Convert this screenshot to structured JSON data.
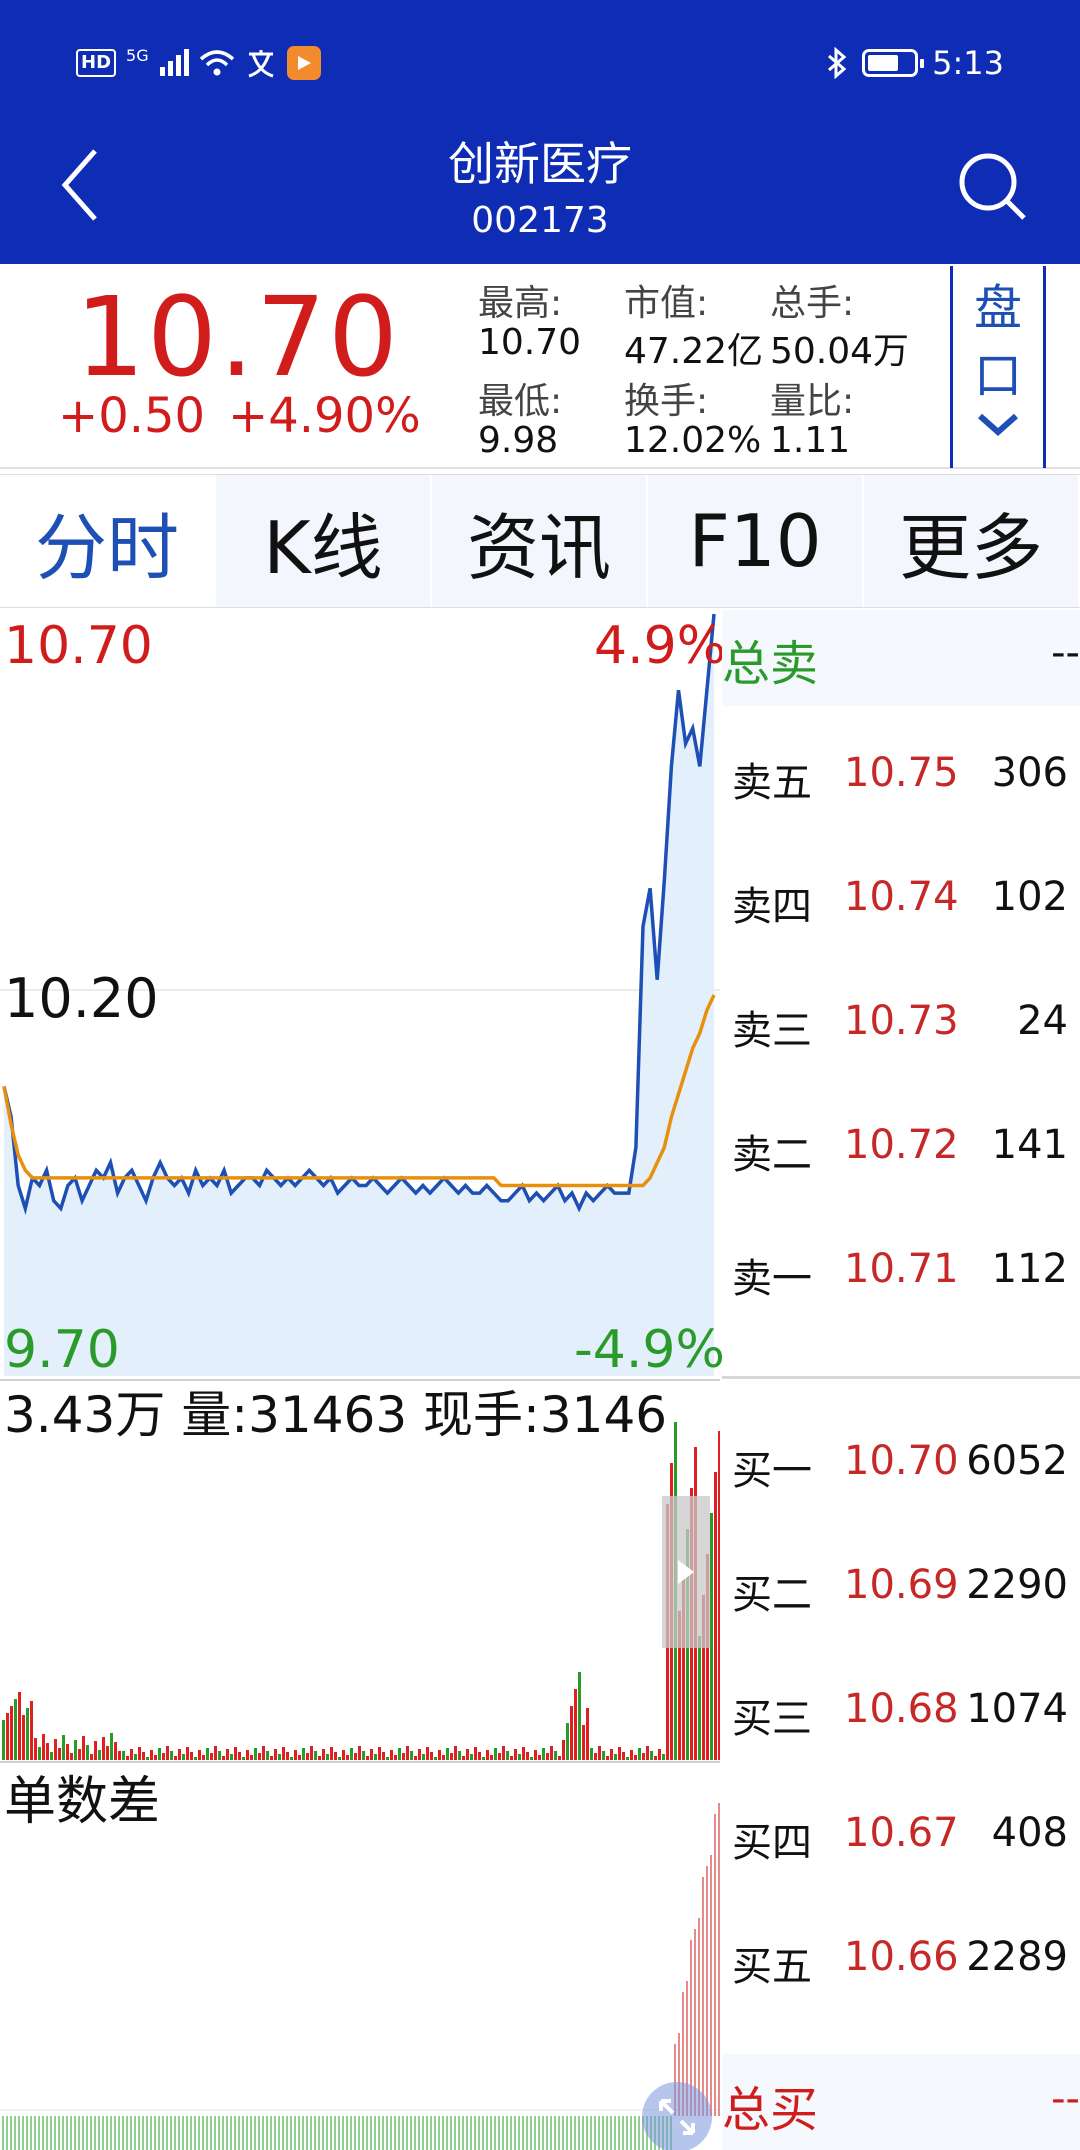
{
  "status_bar": {
    "hd": "HD",
    "network": "5G",
    "app_badge_icon": "orange-play-icon",
    "time": "5:13"
  },
  "header": {
    "name": "创新医疗",
    "code": "002173",
    "back_icon": "chevron-left-icon",
    "search_icon": "search-icon",
    "background": "#0f2db4"
  },
  "quote": {
    "price": "10.70",
    "change": "+0.50",
    "change_pct": "+4.90%",
    "stats": [
      {
        "label": "最高:",
        "value": "10.70"
      },
      {
        "label": "市值:",
        "value": "47.22亿"
      },
      {
        "label": "总手:",
        "value": "50.04万"
      },
      {
        "label": "最低:",
        "value": "9.98"
      },
      {
        "label": "换手:",
        "value": "12.02%"
      },
      {
        "label": "量比:",
        "value": "1.11"
      }
    ],
    "pankou": [
      "盘",
      "口"
    ],
    "pankou_icon": "chevron-down-icon",
    "up_color": "#d11c1c"
  },
  "tabs": [
    {
      "label": "分时",
      "active": true
    },
    {
      "label": "K线",
      "active": false
    },
    {
      "label": "资讯",
      "active": false
    },
    {
      "label": "F10",
      "active": false
    },
    {
      "label": "更多",
      "active": false
    }
  ],
  "chart": {
    "price_top": "10.70",
    "price_mid": "10.20",
    "price_bottom": "9.70",
    "pct_top": "4.9%",
    "pct_bottom": "-4.9%",
    "volume_info": "3.43万 量:31463 现手:3146",
    "lower_label": "单数差",
    "expand_icon": "expand-icon",
    "drawer_icon": "play-right-icon"
  },
  "chart_data": {
    "type": "line",
    "ylim": [
      9.7,
      10.7
    ],
    "y_labels": [
      "10.70",
      "10.20",
      "9.70"
    ],
    "pct_labels": [
      "4.9%",
      "-4.9%"
    ],
    "series": [],
    "price_series": [
      10.08,
      10.04,
      9.95,
      9.92,
      9.96,
      9.95,
      9.97,
      9.93,
      9.92,
      9.95,
      9.96,
      9.93,
      9.95,
      9.97,
      9.96,
      9.98,
      9.94,
      9.96,
      9.97,
      9.95,
      9.93,
      9.96,
      9.98,
      9.96,
      9.95,
      9.96,
      9.94,
      9.97,
      9.95,
      9.96,
      9.95,
      9.97,
      9.94,
      9.95,
      9.96,
      9.96,
      9.95,
      9.97,
      9.96,
      9.95,
      9.96,
      9.95,
      9.96,
      9.97,
      9.96,
      9.95,
      9.96,
      9.94,
      9.95,
      9.96,
      9.95,
      9.95,
      9.96,
      9.95,
      9.94,
      9.95,
      9.96,
      9.95,
      9.94,
      9.95,
      9.94,
      9.95,
      9.96,
      9.95,
      9.94,
      9.95,
      9.94,
      9.94,
      9.95,
      9.94,
      9.93,
      9.93,
      9.94,
      9.95,
      9.93,
      9.94,
      9.93,
      9.94,
      9.95,
      9.93,
      9.94,
      9.92,
      9.94,
      9.93,
      9.94,
      9.95,
      9.94,
      9.94,
      9.94,
      10.0,
      10.29,
      10.34,
      10.22,
      10.35,
      10.5,
      10.6,
      10.53,
      10.55,
      10.5,
      10.6,
      10.7
    ],
    "avg_series": [
      10.08,
      10.03,
      9.99,
      9.97,
      9.96,
      9.96,
      9.96,
      9.96,
      9.96,
      9.96,
      9.96,
      9.96,
      9.96,
      9.96,
      9.96,
      9.96,
      9.96,
      9.96,
      9.96,
      9.96,
      9.96,
      9.96,
      9.96,
      9.96,
      9.96,
      9.96,
      9.96,
      9.96,
      9.96,
      9.96,
      9.96,
      9.96,
      9.96,
      9.96,
      9.96,
      9.96,
      9.96,
      9.96,
      9.96,
      9.96,
      9.96,
      9.96,
      9.96,
      9.96,
      9.96,
      9.96,
      9.96,
      9.96,
      9.96,
      9.96,
      9.96,
      9.96,
      9.96,
      9.96,
      9.96,
      9.96,
      9.96,
      9.96,
      9.96,
      9.96,
      9.96,
      9.96,
      9.96,
      9.96,
      9.96,
      9.96,
      9.96,
      9.96,
      9.96,
      9.96,
      9.95,
      9.95,
      9.95,
      9.95,
      9.95,
      9.95,
      9.95,
      9.95,
      9.95,
      9.95,
      9.95,
      9.95,
      9.95,
      9.95,
      9.95,
      9.95,
      9.95,
      9.95,
      9.95,
      9.95,
      9.95,
      9.96,
      9.98,
      10.0,
      10.04,
      10.07,
      10.1,
      10.13,
      10.15,
      10.18,
      10.2
    ],
    "price_color": "#1d4fb4",
    "avg_color": "#e8900e",
    "up_color": "#e02020",
    "down_color": "#2a9a2a"
  },
  "order_book": {
    "sell_total_label": "总卖",
    "sell_total_value": "--",
    "buy_total_label": "总买",
    "buy_total_value": "--",
    "asks": [
      {
        "label": "卖五",
        "price": "10.75",
        "volume": "306"
      },
      {
        "label": "卖四",
        "price": "10.74",
        "volume": "102"
      },
      {
        "label": "卖三",
        "price": "10.73",
        "volume": "24"
      },
      {
        "label": "卖二",
        "price": "10.72",
        "volume": "141"
      },
      {
        "label": "卖一",
        "price": "10.71",
        "volume": "112"
      }
    ],
    "bids": [
      {
        "label": "买一",
        "price": "10.70",
        "volume": "6052"
      },
      {
        "label": "买二",
        "price": "10.69",
        "volume": "2290"
      },
      {
        "label": "买三",
        "price": "10.68",
        "volume": "1074"
      },
      {
        "label": "买四",
        "price": "10.67",
        "volume": "408"
      },
      {
        "label": "买五",
        "price": "10.66",
        "volume": "2289"
      }
    ]
  }
}
